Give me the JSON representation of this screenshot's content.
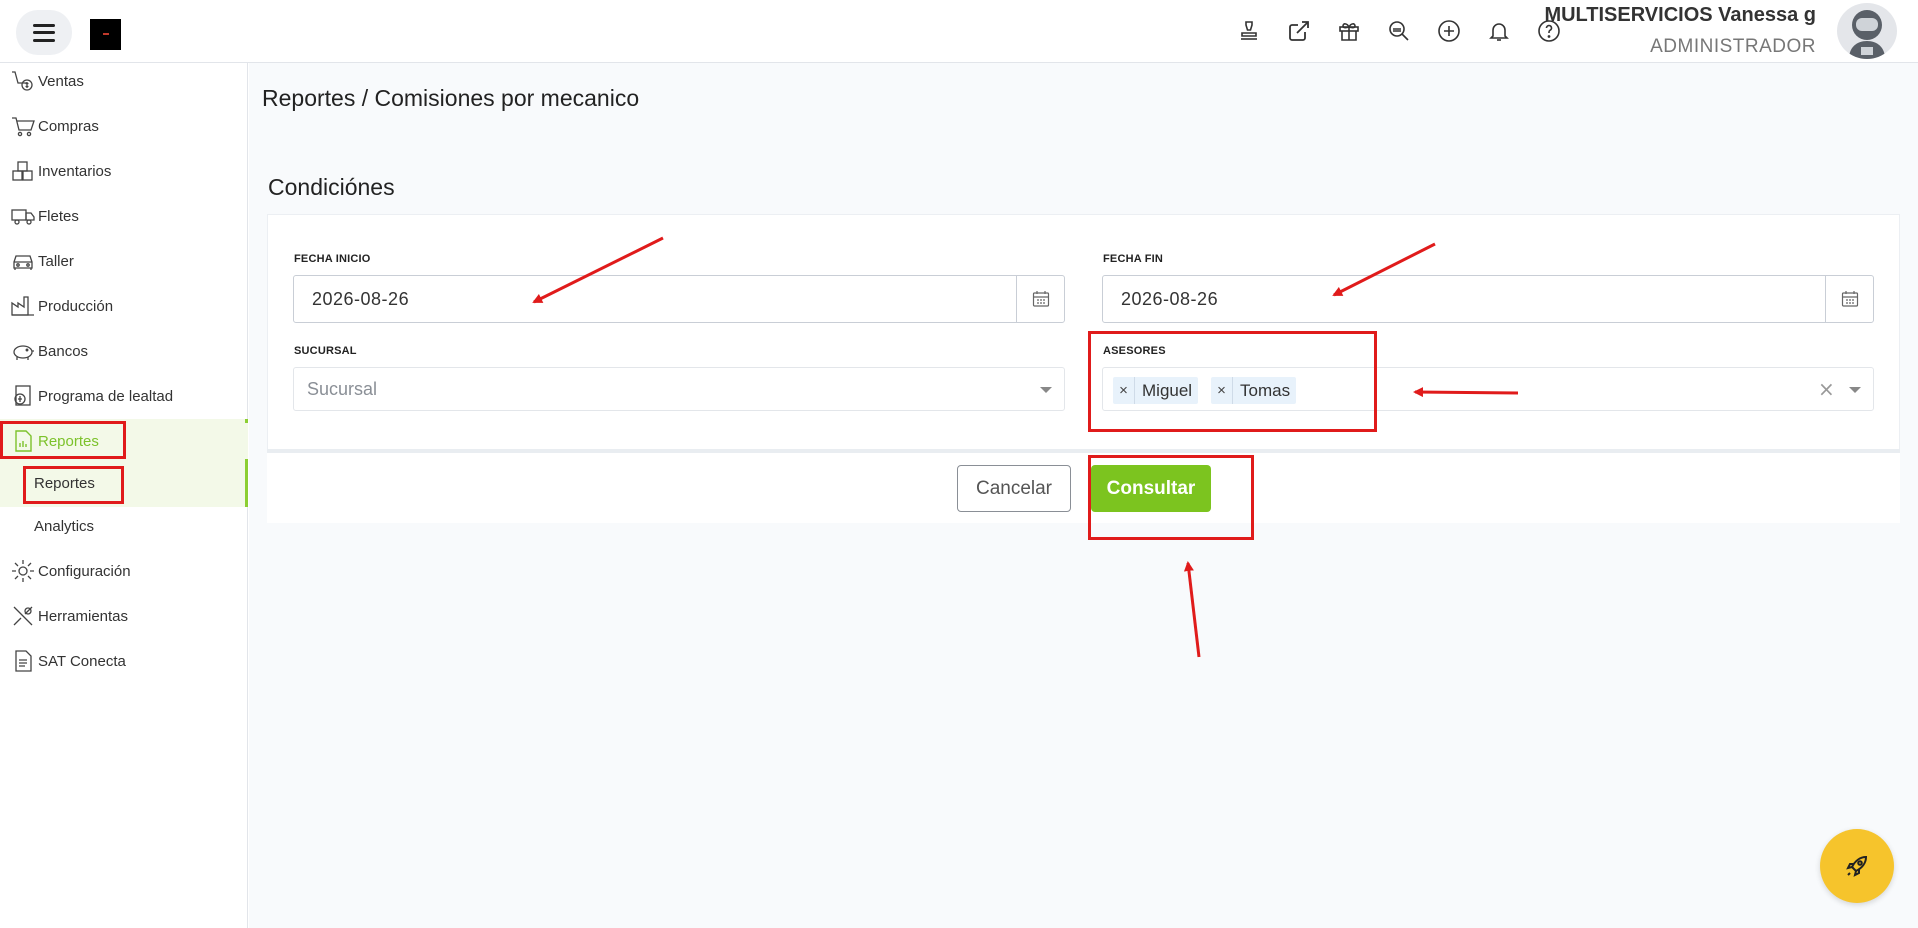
{
  "topbar": {
    "menu_icon": "hamburger-icon",
    "icons": [
      "stamp-icon",
      "external-link-icon",
      "gift-icon",
      "search-zoom-icon",
      "add-circle-icon",
      "bell-icon",
      "help-icon"
    ],
    "user_name": "MULTISERVICIOS Vanessa g",
    "user_role": "ADMINISTRADOR"
  },
  "sidebar": {
    "items": [
      {
        "label": "Ventas",
        "icon": "sales-icon"
      },
      {
        "label": "Compras",
        "icon": "cart-icon"
      },
      {
        "label": "Inventarios",
        "icon": "boxes-icon"
      },
      {
        "label": "Fletes",
        "icon": "truck-icon"
      },
      {
        "label": "Taller",
        "icon": "car-icon"
      },
      {
        "label": "Producción",
        "icon": "factory-icon"
      },
      {
        "label": "Bancos",
        "icon": "piggy-bank-icon"
      },
      {
        "label": "Programa de lealtad",
        "icon": "loyalty-icon"
      },
      {
        "label": "Reportes",
        "icon": "report-icon"
      },
      {
        "label": "Configuración",
        "icon": "gear-icon"
      },
      {
        "label": "Herramientas",
        "icon": "tools-icon"
      },
      {
        "label": "SAT Conecta",
        "icon": "document-icon"
      }
    ],
    "sub_items": [
      "Reportes",
      "Analytics"
    ],
    "active_color": "#7cc22b"
  },
  "main": {
    "breadcrumb": "Reportes /  Comisiones por mecanico",
    "section_title": "Condiciónes",
    "form": {
      "fecha_inicio_label": "FECHA INICIO",
      "fecha_inicio_value": "2026-08-26",
      "fecha_fin_label": "FECHA FIN",
      "fecha_fin_value": "2026-08-26",
      "sucursal_label": "SUCURSAL",
      "sucursal_placeholder": "Sucursal",
      "asesores_label": "ASESORES",
      "asesores_selected": [
        "Miguel",
        "Tomas"
      ],
      "tag_remove": "×",
      "clear_all": "×"
    },
    "buttons": {
      "cancel": "Cancelar",
      "submit": "Consultar"
    },
    "accent_color": "#7cc41f"
  },
  "fab": {
    "icon": "rocket-icon",
    "color": "#f6c42c"
  },
  "annotations": {
    "color": "#e01b1b"
  }
}
